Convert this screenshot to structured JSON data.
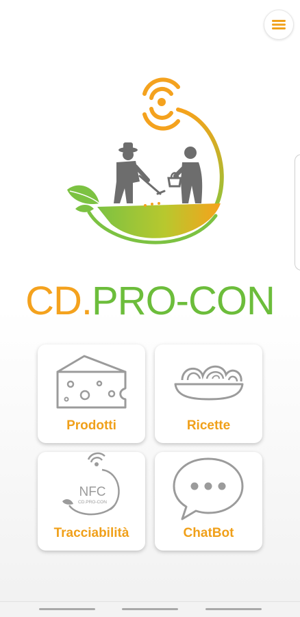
{
  "app": {
    "brand_part1": "CD.",
    "brand_part2": "PRO-CON"
  },
  "tiles": [
    {
      "label": "Prodotti",
      "icon": "cheese-icon"
    },
    {
      "label": "Ricette",
      "icon": "pasta-bowl-icon"
    },
    {
      "label": "Tracciabilità",
      "icon": "nfc-logo-icon"
    },
    {
      "label": "ChatBot",
      "icon": "chat-bubble-icon"
    }
  ],
  "nfc_logo": {
    "main": "NFC",
    "sub": "CD.PRO-CON"
  },
  "colors": {
    "orange": "#f4a21e",
    "green": "#6cbd3b",
    "icon_gray": "#9b9b9b"
  }
}
